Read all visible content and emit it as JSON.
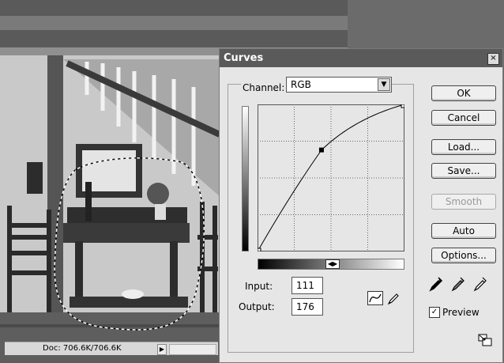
{
  "status_bar": {
    "doc_size": "Doc: 706.6K/706.6K"
  },
  "dialog": {
    "title": "Curves",
    "channel_label": "Channel:",
    "channel_value": "RGB",
    "input_label": "Input:",
    "input_value": "111",
    "output_label": "Output:",
    "output_value": "176",
    "buttons": {
      "ok": "OK",
      "cancel": "Cancel",
      "load": "Load...",
      "save": "Save...",
      "smooth": "Smooth",
      "auto": "Auto",
      "options": "Options..."
    },
    "preview_label": "Preview",
    "preview_checked": true
  },
  "curve_points": {
    "input": [
      0,
      111,
      255
    ],
    "output": [
      0,
      176,
      255
    ]
  }
}
